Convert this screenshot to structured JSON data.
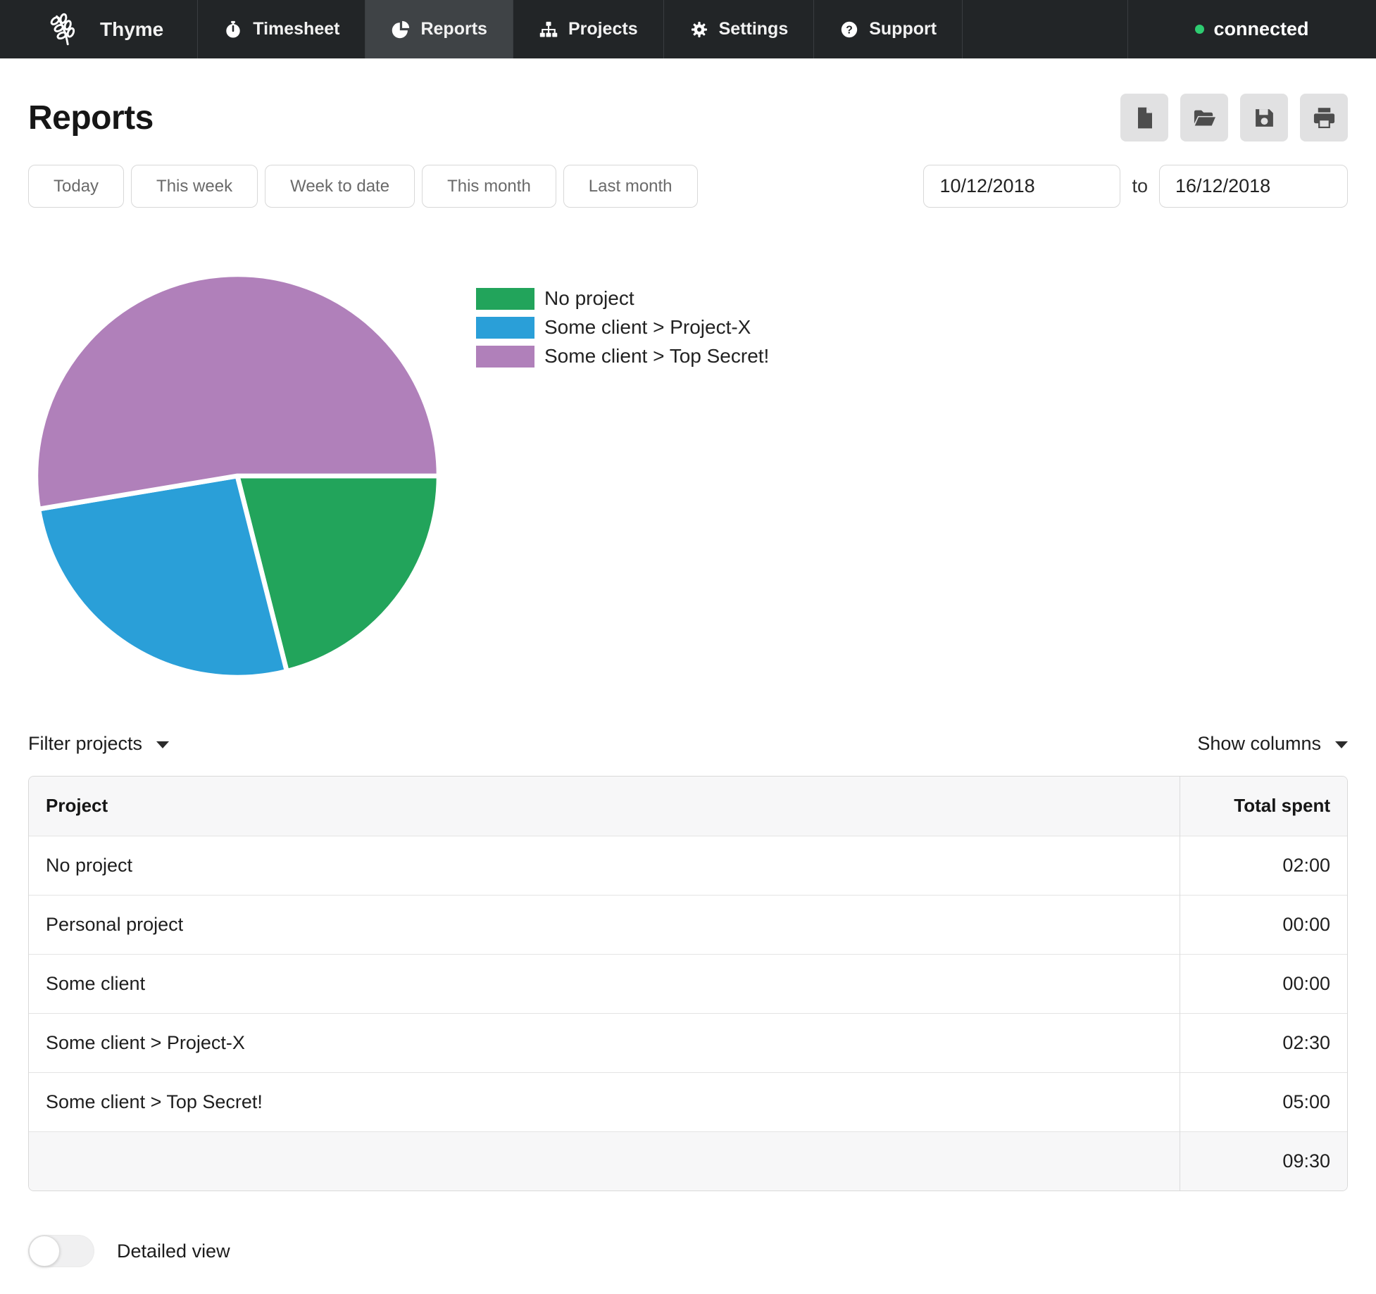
{
  "nav": {
    "brand": "Thyme",
    "items": [
      {
        "label": "Timesheet",
        "icon": "stopwatch-icon",
        "active": false
      },
      {
        "label": "Reports",
        "icon": "pie-chart-icon",
        "active": true
      },
      {
        "label": "Projects",
        "icon": "sitemap-icon",
        "active": false
      },
      {
        "label": "Settings",
        "icon": "gear-icon",
        "active": false
      },
      {
        "label": "Support",
        "icon": "question-circle-icon",
        "active": false
      }
    ],
    "status": {
      "label": "connected",
      "dot_color": "#2ecc71"
    }
  },
  "header": {
    "title": "Reports"
  },
  "toolbar": {
    "buttons": [
      "new-report",
      "open-report",
      "save-report",
      "print-report"
    ]
  },
  "quick_ranges": [
    "Today",
    "This week",
    "Week to date",
    "This month",
    "Last month"
  ],
  "date_range": {
    "from": "10/12/2018",
    "separator": "to",
    "to": "16/12/2018"
  },
  "chart_data": {
    "type": "pie",
    "title": "",
    "legend_position": "right",
    "start_angle_deg": 0,
    "direction": "clockwise",
    "total_hours": 9.5,
    "total_display": "09:30",
    "slices": [
      {
        "label": "No project",
        "value_hours": 2.0,
        "display": "02:00",
        "percent": 21.1,
        "color": "#22a45b"
      },
      {
        "label": "Some client > Project-X",
        "value_hours": 2.5,
        "display": "02:30",
        "percent": 26.3,
        "color": "#2a9fd8"
      },
      {
        "label": "Some client > Top Secret!",
        "value_hours": 5.0,
        "display": "05:00",
        "percent": 52.6,
        "color": "#b080ba"
      }
    ]
  },
  "filters": {
    "filter_projects_label": "Filter projects",
    "show_columns_label": "Show columns"
  },
  "table": {
    "columns": [
      "Project",
      "Total spent"
    ],
    "rows": [
      [
        "No project",
        "02:00"
      ],
      [
        "Personal project",
        "00:00"
      ],
      [
        "Some client",
        "00:00"
      ],
      [
        "Some client > Project-X",
        "02:30"
      ],
      [
        "Some client > Top Secret!",
        "05:00"
      ]
    ],
    "total": "09:30"
  },
  "footer": {
    "detailed_view_label": "Detailed view",
    "toggle_state": "off"
  }
}
